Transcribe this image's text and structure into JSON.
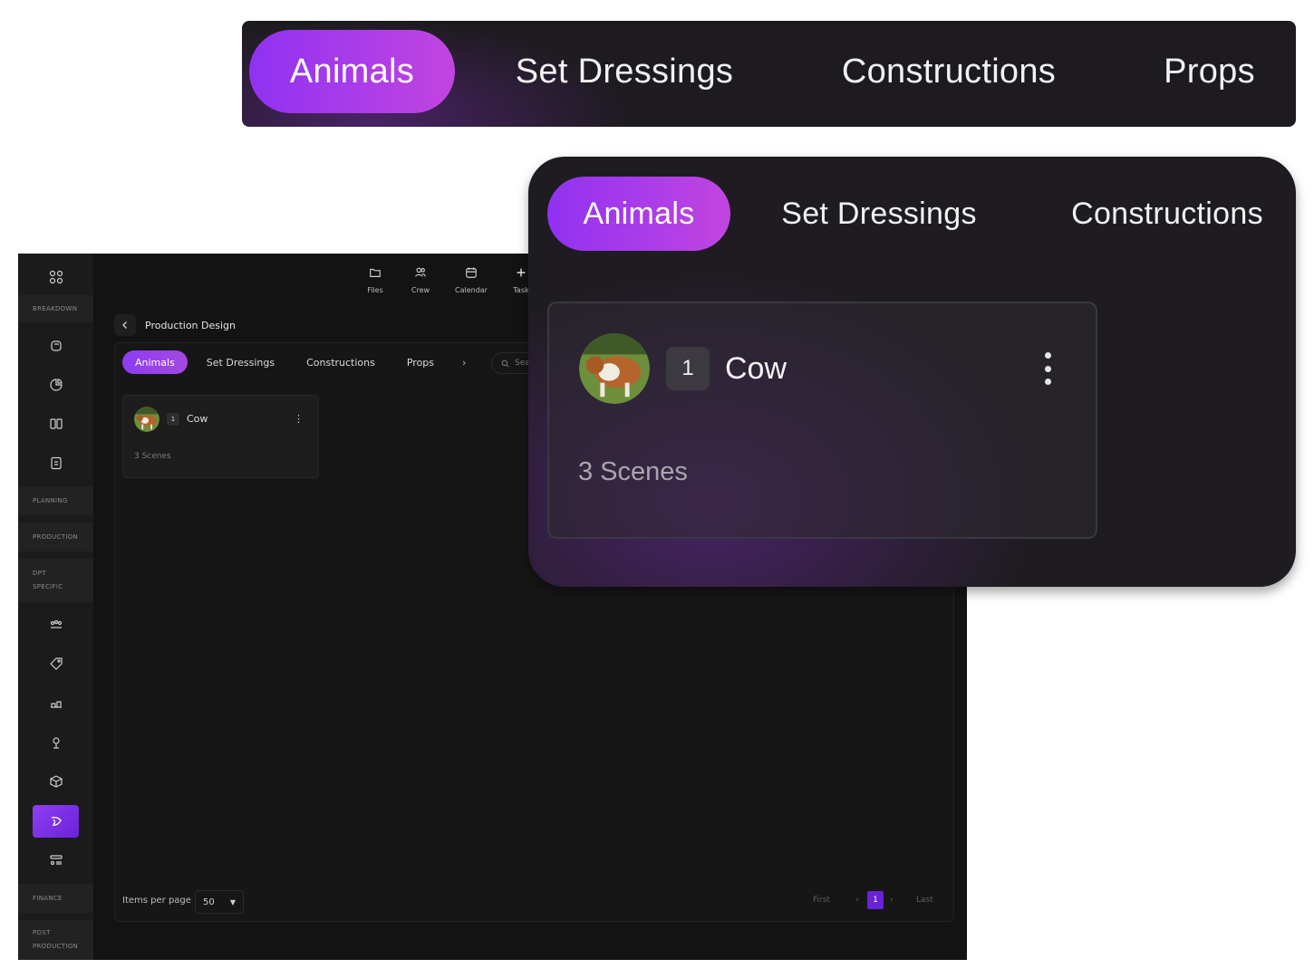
{
  "sidebar": {
    "sections": {
      "breakdown": "BREAKDOWN",
      "planning": "PLANNING",
      "production": "PRODUCTION",
      "dpt_specific_line1": "DPT",
      "dpt_specific_line2": "SPECIFIC",
      "finance": "FINANCE",
      "post_line1": "POST",
      "post_line2": "PRODUCTION"
    },
    "accent": "#8f3ff5"
  },
  "topnav": {
    "files": "Files",
    "crew": "Crew",
    "calendar": "Calendar",
    "tasks": "Task"
  },
  "breadcrumb": {
    "title": "Production Design"
  },
  "tabs": [
    "Animals",
    "Set Dressings",
    "Constructions",
    "Props"
  ],
  "search": {
    "placeholder": "Sea"
  },
  "card": {
    "number": "1",
    "name": "Cow",
    "scenes": "3 Scenes"
  },
  "pagination": {
    "items_per_page_label": "Items per page",
    "items_per_page_value": "50",
    "first": "First",
    "prev": "‹",
    "current": "1",
    "next": "›",
    "last": "Last"
  },
  "colors": {
    "tab_active_start": "#9032f2",
    "tab_active_end": "#c245e0",
    "background": "#131313"
  }
}
